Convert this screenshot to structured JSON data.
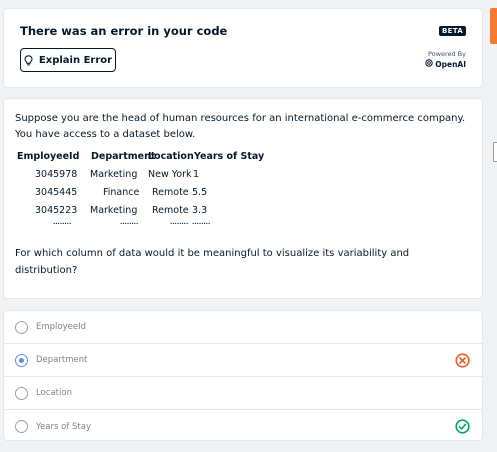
{
  "error": {
    "title": "There was an error in your code",
    "beta_label": "BETA",
    "explain_button_label": "Explain Error",
    "powered_by_label": "Powered By",
    "brand_label": "OpenAI"
  },
  "question": {
    "intro": "Suppose you are the head of human resources for an international e-commerce company. You have access to a dataset below.",
    "table": {
      "headers": [
        "EmployeeId",
        "Department",
        "Location",
        "Years of Stay"
      ],
      "rows": [
        [
          "3045978",
          "Marketing",
          "New York",
          "1"
        ],
        [
          "3045445",
          "Finance",
          "Remote",
          "5.5"
        ],
        [
          "3045223",
          "Marketing",
          "Remote",
          "3.3"
        ],
        [
          "........",
          "........",
          "........",
          "........"
        ]
      ]
    },
    "ask": "For which column of data would it be meaningful to visualize its variability and distribution?"
  },
  "options": [
    {
      "label": "EmployeeId",
      "selected": false,
      "status": ""
    },
    {
      "label": "Department",
      "selected": true,
      "status": "incorrect"
    },
    {
      "label": "Location",
      "selected": false,
      "status": ""
    },
    {
      "label": "Years of Stay",
      "selected": false,
      "status": "correct"
    }
  ],
  "colors": {
    "incorrect": "#f15a24",
    "correct": "#03a65f",
    "selected": "#5b8ff5",
    "accent_tab": "#f47a32"
  },
  "icons": {
    "explain": "lightbulb-icon",
    "brand": "openai-icon",
    "incorrect": "x-circle-icon",
    "correct": "check-circle-icon"
  }
}
